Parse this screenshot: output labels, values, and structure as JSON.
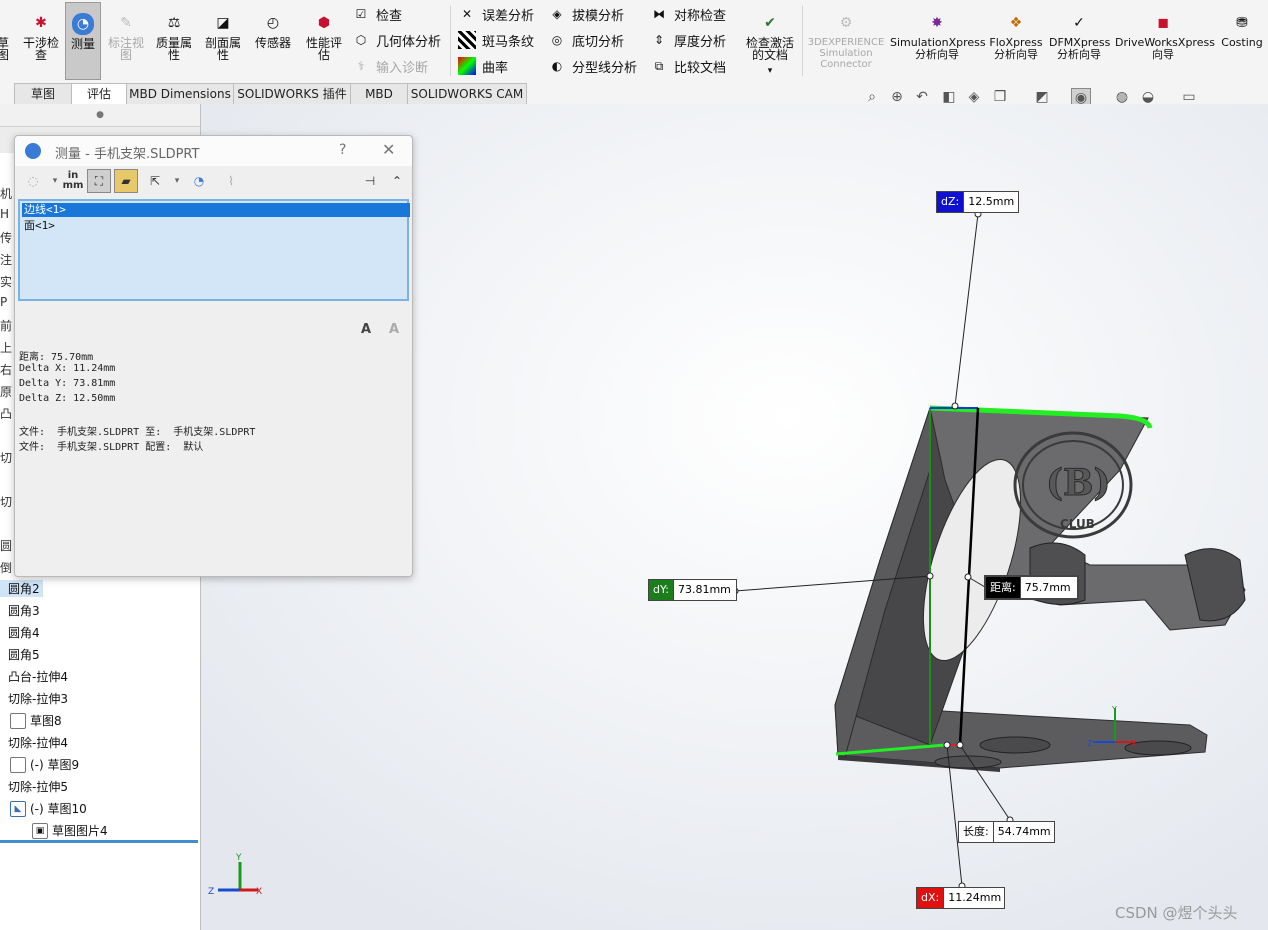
{
  "ribbon": {
    "big": [
      {
        "label": "草图",
        "id": "sketch"
      },
      {
        "label": "干涉检查",
        "id": "interference"
      },
      {
        "label": "测量",
        "id": "measure"
      },
      {
        "label": "标注视图",
        "id": "annotate"
      },
      {
        "label": "质量属性",
        "id": "mass"
      },
      {
        "label": "剖面属性",
        "id": "section"
      },
      {
        "label": "传感器",
        "id": "sensor"
      },
      {
        "label": "性能评估",
        "id": "performance"
      }
    ],
    "col1": [
      {
        "label": "检查",
        "id": "check"
      },
      {
        "label": "几何体分析",
        "id": "geometry-analysis"
      },
      {
        "label": "输入诊断",
        "id": "import-diagnostics"
      }
    ],
    "col2": [
      {
        "label": "误差分析",
        "id": "deviation-analysis"
      },
      {
        "label": "斑马条纹",
        "id": "zebra"
      },
      {
        "label": "曲率",
        "id": "curvature"
      }
    ],
    "col3": [
      {
        "label": "拔模分析",
        "id": "draft-analysis"
      },
      {
        "label": "底切分析",
        "id": "undercut"
      },
      {
        "label": "分型线分析",
        "id": "parting-line"
      }
    ],
    "col4": [
      {
        "label": "对称检查",
        "id": "symmetry"
      },
      {
        "label": "厚度分析",
        "id": "thickness"
      },
      {
        "label": "比较文档",
        "id": "compare"
      }
    ],
    "check_active_doc": "检查激活的文档",
    "experience": "3DEXPERIENCE Simulation Connector",
    "simx": "SimulationXpress 分析向导",
    "flox": "FloXpress 分析向导",
    "dfmx": "DFMXpress 分析向导",
    "dwx": "DriveWorksXpress 向导",
    "costing": "Costing"
  },
  "tabs": [
    "草图",
    "评估",
    "MBD Dimensions",
    "SOLIDWORKS 插件",
    "MBD",
    "SOLIDWORKS CAM"
  ],
  "tree": {
    "fragments": [
      "机",
      "H",
      "传",
      "注",
      "实",
      "P",
      "前",
      "上",
      "右",
      "原",
      "凸",
      "",
      "切",
      "",
      "切",
      "",
      "圆",
      "倒"
    ],
    "items": [
      {
        "label": "圆角2",
        "selected": true
      },
      {
        "label": "圆角3"
      },
      {
        "label": "圆角4"
      },
      {
        "label": "圆角5"
      },
      {
        "label": "凸台-拉伸4"
      },
      {
        "label": "切除-拉伸3"
      },
      {
        "label": "草图8",
        "indent": true
      },
      {
        "label": "切除-拉伸4"
      },
      {
        "label": "(-) 草图9",
        "indent": true
      },
      {
        "label": "切除-拉伸5"
      },
      {
        "label": "(-) 草图10",
        "indent": true
      },
      {
        "label": "草图图片4",
        "indent2": true
      }
    ]
  },
  "dialog": {
    "title": "测量 - 手机支架.SLDPRT",
    "help": "?",
    "units_label": "in mm",
    "selections": [
      "边线<1>",
      "面<1>"
    ],
    "results": [
      "距离: 75.70mm",
      "Delta X: 11.24mm",
      "Delta Y: 73.81mm",
      "Delta Z: 12.50mm",
      "",
      "文件:  手机支架.SLDPRT 至:  手机支架.SLDPRT",
      "文件:  手机支架.SLDPRT 配置:  默认"
    ]
  },
  "callouts": {
    "dz": {
      "label": "dZ:",
      "value": "12.5mm",
      "color": "#1010d0"
    },
    "dy": {
      "label": "dY:",
      "value": "73.81mm",
      "color": "#1b7d1b"
    },
    "dist": {
      "label": "距离:",
      "value": "75.7mm",
      "color": "#000000"
    },
    "len": {
      "label": "长度:",
      "value": "54.74mm",
      "color": "#ffffff"
    },
    "dx": {
      "label": "dX:",
      "value": "11.24mm",
      "color": "#e01010"
    }
  },
  "model_text": "CLUB",
  "axes": {
    "x": "X",
    "y": "Y",
    "z": "Z"
  },
  "watermark": "CSDN @煜个头头"
}
